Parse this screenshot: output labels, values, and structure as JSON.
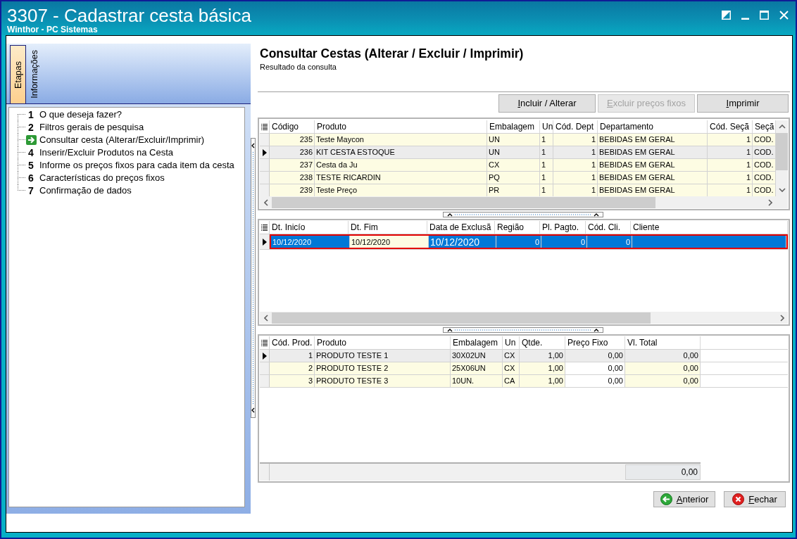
{
  "window": {
    "title": "3307 - Cadastrar cesta básica",
    "subtitle": "Winthor - PC Sistemas"
  },
  "side_tabs": [
    {
      "label": "Etapas",
      "selected": true
    },
    {
      "label": "Informações",
      "selected": false
    }
  ],
  "steps": [
    {
      "number": "1",
      "label": "O que deseja fazer?",
      "current": false
    },
    {
      "number": "2",
      "label": "Filtros gerais de pesquisa",
      "current": false
    },
    {
      "label": "Consultar cesta (Alterar/Excluir/Imprimir)",
      "current": true
    },
    {
      "number": "4",
      "label": "Inserir/Excluir Produtos na Cesta",
      "current": false
    },
    {
      "number": "5",
      "label": "Informe os preços fixos para cada item da cesta",
      "current": false
    },
    {
      "number": "6",
      "label": "Características do preços fixos",
      "current": false
    },
    {
      "number": "7",
      "label": "Confirmação de dados",
      "current": false
    }
  ],
  "page": {
    "heading": "Consultar Cestas (Alterar / Excluir / Imprimir)",
    "subheading": "Resultado da consulta"
  },
  "actions": [
    {
      "label": "Incluir / Alterar",
      "disabled": false
    },
    {
      "label": "Excluir preços fixos",
      "disabled": true
    },
    {
      "label": "Imprimir",
      "disabled": false
    }
  ],
  "baskets": {
    "focused": false,
    "columns": [
      {
        "label": "Código"
      },
      {
        "label": "Produto"
      },
      {
        "label": "Embalagem"
      },
      {
        "label": "Un"
      },
      {
        "label": "Cód. Dept"
      },
      {
        "label": "Departamento"
      },
      {
        "label": "Cód. Seçã"
      },
      {
        "label": "Seçã"
      }
    ],
    "rows": [
      {
        "selected": false,
        "cells": [
          "235",
          "Teste Maycon",
          "UN",
          "1",
          "1",
          "BEBIDAS EM GERAL",
          "1",
          "COD."
        ]
      },
      {
        "selected": true,
        "cells": [
          "236",
          "KIT CESTA ESTOQUE",
          "UN",
          "1",
          "1",
          "BEBIDAS EM GERAL",
          "1",
          "COD."
        ]
      },
      {
        "selected": false,
        "cells": [
          "237",
          "Cesta da Ju",
          "CX",
          "1",
          "1",
          "BEBIDAS EM GERAL",
          "1",
          "COD."
        ]
      },
      {
        "selected": false,
        "cells": [
          "238",
          "TESTE RICARDIN",
          "PQ",
          "1",
          "1",
          "BEBIDAS EM GERAL",
          "1",
          "COD."
        ]
      },
      {
        "selected": false,
        "cells": [
          "239",
          "Teste Preço",
          "PR",
          "1",
          "1",
          "BEBIDAS EM GERAL",
          "1",
          "COD."
        ]
      }
    ]
  },
  "validity": {
    "focused": true,
    "columns": [
      {
        "label": "Dt. Inicío"
      },
      {
        "label": "Dt. Fim"
      },
      {
        "label": "Data de Exclusã"
      },
      {
        "label": "Região"
      },
      {
        "label": "Pl. Pagto."
      },
      {
        "label": "Cód. Cli."
      },
      {
        "label": "Cliente"
      }
    ],
    "rows": [
      {
        "selected": true,
        "highlighted": true,
        "cells": [
          {
            "text": "10/12/2020",
            "focused": false
          },
          {
            "text": "10/12/2020",
            "focused": true
          },
          {
            "text": "10/12/2020",
            "focused": false
          },
          {
            "text": "0",
            "focused": false
          },
          {
            "text": "0",
            "focused": false
          },
          {
            "text": "0",
            "focused": false
          }
        ]
      }
    ]
  },
  "items": {
    "focused": false,
    "columns": [
      {
        "label": "Cód. Prod.",
        "editable": false
      },
      {
        "label": "Produto",
        "editable": false
      },
      {
        "label": "Embalagem",
        "editable": false
      },
      {
        "label": "Un",
        "editable": false
      },
      {
        "label": "Qtde.",
        "editable": false
      },
      {
        "label": "Preço Fixo",
        "editable": true
      },
      {
        "label": "Vl. Total",
        "editable": false
      }
    ],
    "rows": [
      {
        "selected": true,
        "cells": [
          "1",
          "PRODUTO TESTE 1",
          "30X02UN",
          "CX",
          "1,00",
          "0,00",
          "0,00"
        ]
      },
      {
        "selected": false,
        "cells": [
          "2",
          "PRODUTO TESTE 2",
          "25X06UN",
          "CX",
          "1,00",
          "0,00",
          "0,00"
        ]
      },
      {
        "selected": false,
        "cells": [
          "3",
          "PRODUTO TESTE 3",
          "10UN.",
          "CA",
          "1,00",
          "0,00",
          "0,00"
        ]
      }
    ],
    "total": "0,00"
  },
  "nav_buttons": [
    {
      "label": "Anterior",
      "kind": "back"
    },
    {
      "label": "Fechar",
      "kind": "close"
    }
  ]
}
